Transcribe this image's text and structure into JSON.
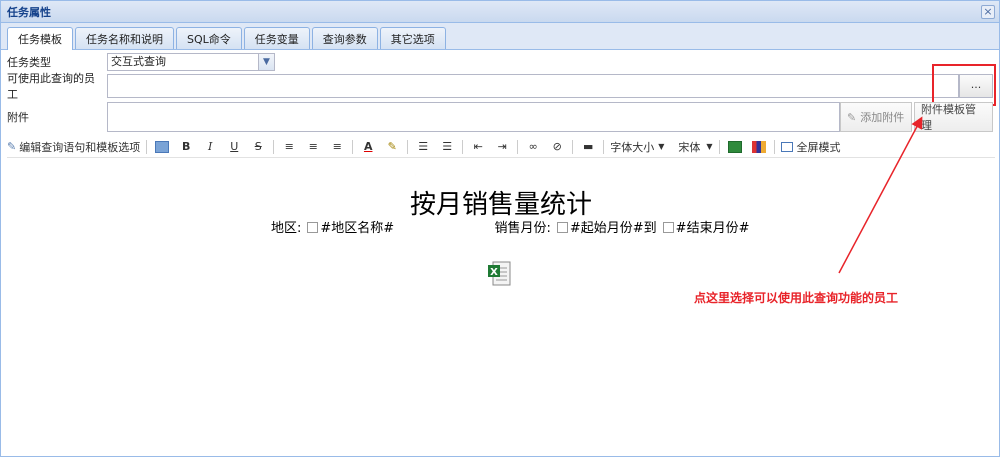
{
  "window": {
    "title": "任务属性"
  },
  "tabs": [
    "任务模板",
    "任务名称和说明",
    "SQL命令",
    "任务变量",
    "查询参数",
    "其它选项"
  ],
  "form": {
    "task_type_label": "任务类型",
    "task_type_value": "交互式查询",
    "employees_label": "可使用此查询的员工",
    "employees_button": "...",
    "attachment_label": "附件",
    "add_attachment_button": "添加附件",
    "attachment_template_button": "附件模板管理"
  },
  "toolbar": {
    "edit_sql_label": "编辑查询语句和模板选项",
    "bold": "B",
    "italic": "I",
    "underline": "U",
    "strike": "S",
    "font_size_label": "字体大小",
    "font_name_label": "宋体",
    "fullscreen_label": "全屏模式"
  },
  "document": {
    "title": "按月销售量统计",
    "region_label": "地区:",
    "region_field": "#地区名称#",
    "month_label": "销售月份:",
    "start_field": "#起始月份#",
    "to_text": "到",
    "end_field": "#结束月份#"
  },
  "annotation": {
    "text": "点这里选择可以使用此查询功能的员工",
    "color": "#e8242a"
  },
  "colors": {
    "border": "#99bbe8",
    "title_text": "#15428b",
    "accent_red": "#e8242a"
  }
}
